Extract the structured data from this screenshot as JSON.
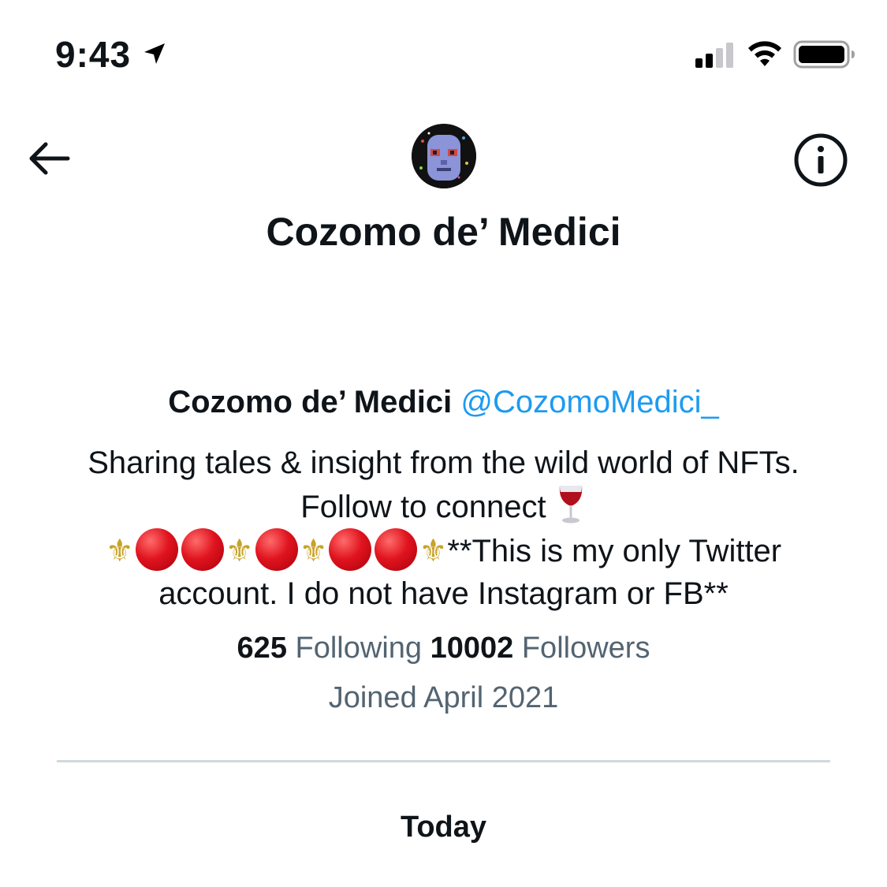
{
  "status_bar": {
    "time": "9:43",
    "location_icon": "location-arrow-icon",
    "signal_icon": "cellular-signal-icon",
    "wifi_icon": "wifi-icon",
    "battery_icon": "battery-icon"
  },
  "nav": {
    "back_icon": "arrow-left-icon",
    "info_icon": "info-icon",
    "title": "Cozomo de’ Medici"
  },
  "profile": {
    "display_name": "Cozomo de’ Medici",
    "handle": "@CozomoMedici_",
    "bio_line1": "Sharing tales & insight from the wild world of NFTs. Follow to connect",
    "bio_fleur": "⚜",
    "bio_line2": "**This is my only Twitter account. I do not have Instagram or FB**",
    "following_count": "625",
    "following_label": "Following",
    "followers_count": "10002",
    "followers_label": "Followers",
    "joined": "Joined April 2021"
  },
  "timeline": {
    "date_header": "Today"
  },
  "colors": {
    "accent": "#1d9bf0",
    "text_primary": "#0f1419",
    "text_secondary": "#536471",
    "divider": "#cfd9de"
  }
}
